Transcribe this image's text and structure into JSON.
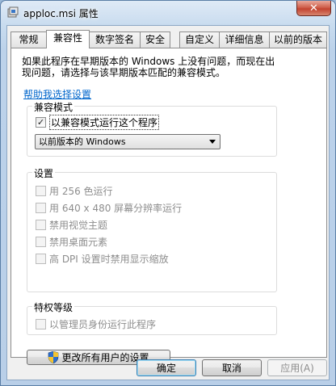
{
  "window": {
    "title": "apploc.msi 属性",
    "close_symbol": "✕"
  },
  "tabs": [
    {
      "label": "常规"
    },
    {
      "label": "兼容性"
    },
    {
      "label": "数字签名"
    },
    {
      "label": "安全"
    },
    {
      "label": "自定义"
    },
    {
      "label": "详细信息"
    },
    {
      "label": "以前的版本"
    }
  ],
  "active_tab": "兼容性",
  "intro": {
    "line1": "如果此程序在早期版本的 Windows 上没有问题，而现在出",
    "line2": "现问题，请选择与该早期版本匹配的兼容模式。"
  },
  "help_link": "帮助我选择设置",
  "compat_group": {
    "title": "兼容模式",
    "checkbox_label": "以兼容模式运行这个程序",
    "checked": true,
    "check_mark": "✓",
    "select_value": "以前版本的 Windows"
  },
  "settings_group": {
    "title": "设置",
    "options": [
      {
        "label": "用 256 色运行"
      },
      {
        "label": "用 640 x 480 屏幕分辨率运行"
      },
      {
        "label": "禁用视觉主题"
      },
      {
        "label": "禁用桌面元素"
      },
      {
        "label": "高 DPI 设置时禁用显示缩放"
      }
    ]
  },
  "privilege_group": {
    "title": "特权等级",
    "option_label": "以管理员身份运行此程序"
  },
  "change_all_button": "更改所有用户的设置",
  "footer": {
    "ok": "确定",
    "cancel": "取消",
    "apply": "应用(A)"
  }
}
